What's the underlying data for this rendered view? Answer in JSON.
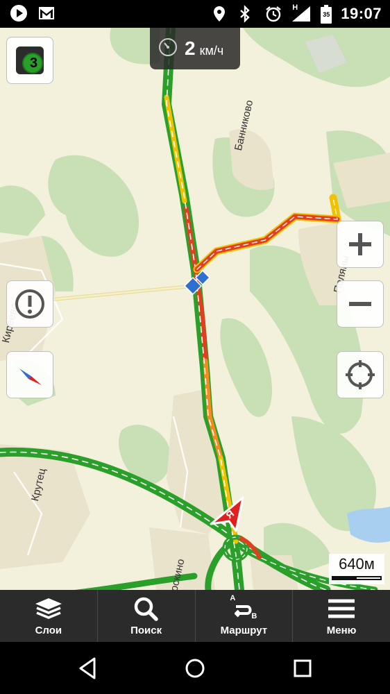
{
  "status_bar": {
    "time": "19:07",
    "icons": [
      "play-store-icon",
      "gmail-icon",
      "location-icon",
      "bluetooth-icon",
      "alarm-icon",
      "network-h-icon",
      "signal-icon",
      "battery-icon"
    ],
    "network_label": "H",
    "battery_label": "35"
  },
  "speed": {
    "value": "2",
    "unit": "км/ч"
  },
  "traffic_badge": {
    "level": "3"
  },
  "map": {
    "labels": {
      "bannikovo": "Банниково",
      "polyany": "Поляны",
      "krutets": "Крутец",
      "doskino": "Доскино",
      "kireevo": "Киреево"
    },
    "scale": "640м",
    "colors": {
      "traffic_free": "#2aa02a",
      "traffic_slow": "#f2c200",
      "traffic_jam": "#e04020",
      "cursor": "#e02020"
    }
  },
  "toolbar": {
    "layers": "Слои",
    "search": "Поиск",
    "route": "Маршрут",
    "menu": "Меню",
    "route_a": "A",
    "route_b": "B"
  }
}
